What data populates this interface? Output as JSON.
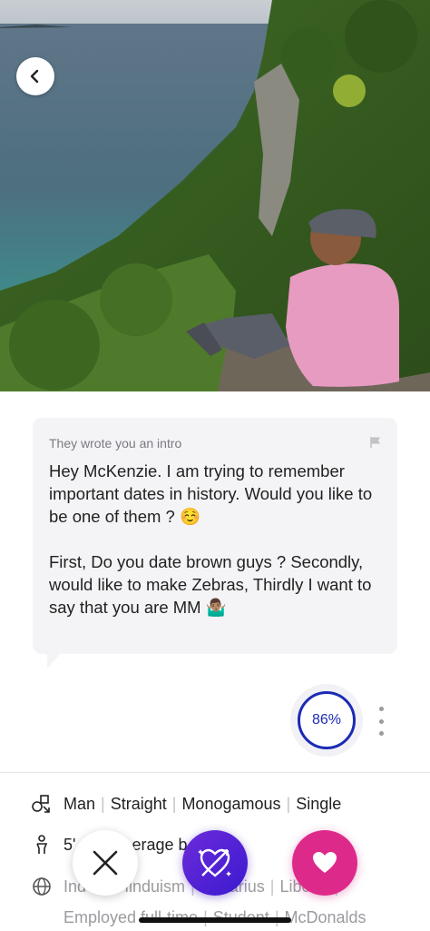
{
  "intro": {
    "label": "They wrote you an intro",
    "paragraph1": "Hey McKenzie. I am trying to remember important dates in history. Would you like to be one of them ? ☺️",
    "paragraph2": "First, Do you date brown guys ? Secondly, would like to make Zebras, Thirdly I want to say that you are MM 🤷🏽‍♂️"
  },
  "match": {
    "score": "86%"
  },
  "details": {
    "identity": [
      "Man",
      "Straight",
      "Monogamous",
      "Single"
    ],
    "body_prefix": "5'",
    "body_suffix": "erage b",
    "background": [
      "Ind",
      "Hinduism",
      "Aquarius",
      "Liberal"
    ],
    "work": [
      "Employed full-time",
      "Student",
      "McDonalds"
    ]
  },
  "icons": {
    "back": "chevron-left-icon",
    "flag": "flag-icon",
    "more": "more-vertical-icon",
    "gender": "gender-shapes-icon",
    "person": "person-icon",
    "globe": "globe-icon",
    "pass": "close-icon",
    "superlike": "heart-arrow-icon",
    "like": "heart-icon"
  },
  "colors": {
    "score_ring": "#1c2bb5",
    "like": "#dd2a8a",
    "superlike_start": "#6c2bd9",
    "superlike_end": "#3b1ad0"
  }
}
